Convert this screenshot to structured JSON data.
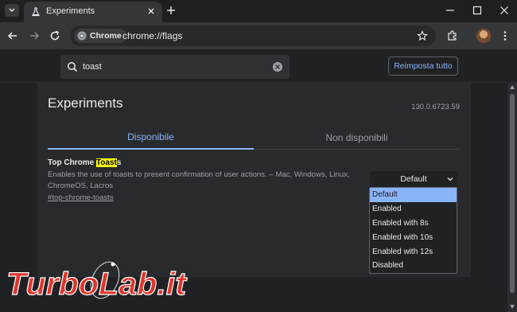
{
  "browser": {
    "tab_title": "Experiments",
    "omnibox_chip": "Chrome",
    "url": "chrome://flags"
  },
  "flags_page": {
    "search_value": "toast",
    "reset_button": "Reimposta tutto",
    "title": "Experiments",
    "version": "130.0.6723.59",
    "tabs": [
      {
        "label": "Disponibile",
        "active": true
      },
      {
        "label": "Non disponibili",
        "active": false
      }
    ],
    "flag": {
      "name_before": "Top Chrome ",
      "name_highlight": "Toast",
      "name_after": "s",
      "description_line1": "Enables the use of toasts to present confirmation of user actions. – Mac, Windows, Linux,",
      "description_line2": "ChromeOS, Lacros",
      "link": "#top-chrome-toasts",
      "selected_value": "Default"
    },
    "dropdown_options": [
      "Default",
      "Enabled",
      "Enabled with 8s",
      "Enabled with 10s",
      "Enabled with 12s",
      "Disabled"
    ]
  },
  "watermark": {
    "text": "TurboLab.it"
  },
  "colors": {
    "accent": "#8ab4f8",
    "highlight": "#ffff00",
    "background": "#202124",
    "panel": "#292a2d",
    "watermark_red": "#e0352b"
  }
}
